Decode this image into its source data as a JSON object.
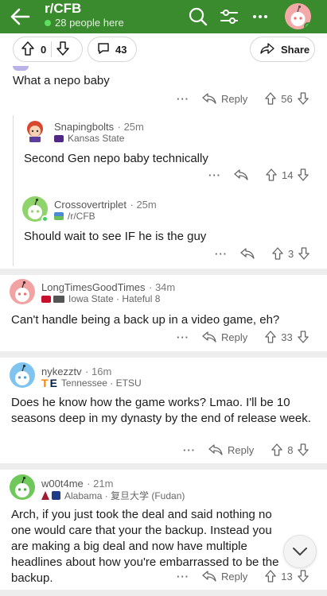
{
  "header": {
    "subreddit": "r/CFB",
    "online": "28 people here"
  },
  "post_actions": {
    "score": "0",
    "comments": "43",
    "share": "Share"
  },
  "comments": [
    {
      "id": "c0",
      "text": "What a nepo baby",
      "score": "56",
      "reply": "Reply"
    },
    {
      "id": "c1",
      "author": "Snapingbolts",
      "time": "25m",
      "flair": "Kansas State",
      "text": "Second Gen nepo baby technically",
      "score": "14"
    },
    {
      "id": "c2",
      "author": "Crossovertriplet",
      "time": "25m",
      "flair": "/r/CFB",
      "text": "Should wait to see IF he is the guy",
      "score": "3"
    },
    {
      "id": "c3",
      "author": "LongTimesGoodTimes",
      "time": "34m",
      "flair": "Iowa State · Hateful 8",
      "text": "Can't handle being a back up in a video game, eh?",
      "score": "33",
      "reply": "Reply"
    },
    {
      "id": "c4",
      "author": "nykezztv",
      "time": "16m",
      "flair": "Tennessee · ETSU",
      "text": "Does he know how the game works? Lmao. I'll be 10 seasons deep in my dynasty by the end of release week.",
      "score": "8",
      "reply": "Reply"
    },
    {
      "id": "c5",
      "author": "w00t4me",
      "time": "21m",
      "flair": "Alabama · 复旦大学 (Fudan)",
      "text": "Arch, if you just took the deal and said nothing no one would care that your the backup. Instead you are making a big deal and now have multiple headlines about how you're embarrassed to be the backup.",
      "score": "13",
      "reply": "Reply"
    }
  ],
  "colors": {
    "header_bg": "#3a8a2e",
    "text": "#1c1c1c",
    "muted": "#666666"
  },
  "icons": [
    "back-arrow-icon",
    "search-icon",
    "filter-icon",
    "more-icon",
    "upvote-icon",
    "downvote-icon",
    "comment-icon",
    "share-icon",
    "reply-icon",
    "chevron-down-icon"
  ]
}
